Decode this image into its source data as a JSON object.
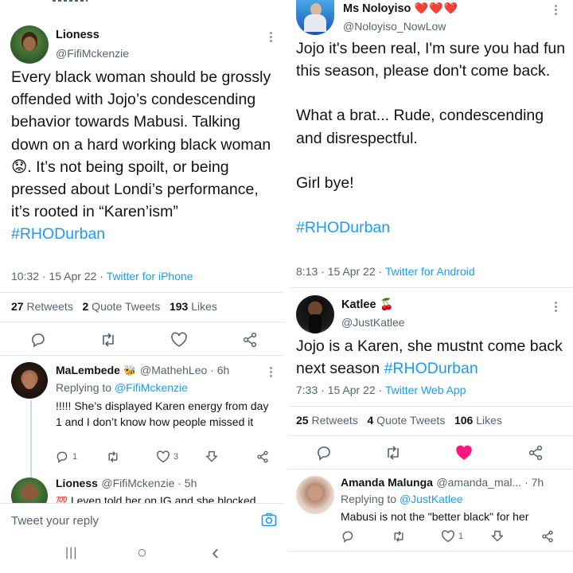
{
  "left": {
    "tweet": {
      "name": "Lioness",
      "handle": "@FifiMckenzie",
      "text_before": "Every black woman should be grossly offended with Jojo’s condescending behavior towards Mabusi. Talking down on a hard working black woman",
      "text_emoji": "😟",
      "text_after": ". It’s not being spoilt, or being pressed about Londi’s performance, it’s rooted in “Karen’ism”",
      "hashtag": "#RHODurban",
      "time": "10:32 · 15 Apr 22 · ",
      "client": "Twitter for iPhone",
      "retweets_count": "27",
      "retweets_label": " Retweets",
      "quotes_count": "2",
      "quotes_label": " Quote Tweets",
      "likes_count": "193",
      "likes_label": " Likes"
    },
    "reply1": {
      "name": "MaLembede",
      "emoji": "🐝",
      "handle_time": "@MathehLeo · 6h",
      "replying_prefix": "Replying to ",
      "replying_to": "@FifiMckenzie",
      "text": "!!!!! She’s displayed Karen energy from day 1 and I don’t know how people missed it",
      "reply_count": "1",
      "like_count": "3"
    },
    "reply2": {
      "name": "Lioness",
      "handle_time": "@FifiMckenzie · 5h",
      "emoji": "💯",
      "text": "I even told her on IG and she blocked"
    },
    "compose": {
      "placeholder": "Tweet your reply"
    },
    "navbar": {
      "recent": "|||",
      "home": "○",
      "back": "‹"
    }
  },
  "right": {
    "tweet1": {
      "name": "Ms Noloyiso",
      "hearts": "❤️❤️❤️",
      "handle": "@Noloyiso_NowLow",
      "line1": "Jojo it's been real, I'm sure you had fun this season, please don't come back.",
      "line2": "What a brat... Rude, condescending and disrespectful.",
      "line3": "Girl bye!",
      "hashtag": "#RHODurban",
      "time": "8:13 · 15 Apr 22 · ",
      "client": "Twitter for Android"
    },
    "tweet2": {
      "name": "Katlee",
      "emoji": "🍒",
      "handle": "@JustKatlee",
      "text": "Jojo is a Karen, she mustnt come back next season ",
      "hashtag": "#RHODurban",
      "time": "7:33 · 15 Apr 22 · ",
      "client": "Twitter Web App",
      "retweets_count": "25",
      "retweets_label": " Retweets",
      "quotes_count": "4",
      "quotes_label": " Quote Tweets",
      "likes_count": "106",
      "likes_label": " Likes"
    },
    "reply": {
      "name": "Amanda Malunga",
      "handle_time": "@amanda_mal... · 7h",
      "replying_prefix": "Replying to ",
      "replying_to": "@JustKatlee",
      "text": "Mabusi is not the \"better black\" for her",
      "like_count": "1"
    }
  },
  "colors": {
    "accent": "#1d9bf0",
    "text": "#0f1419",
    "secondary": "#536471",
    "like_active": "#f91880"
  }
}
